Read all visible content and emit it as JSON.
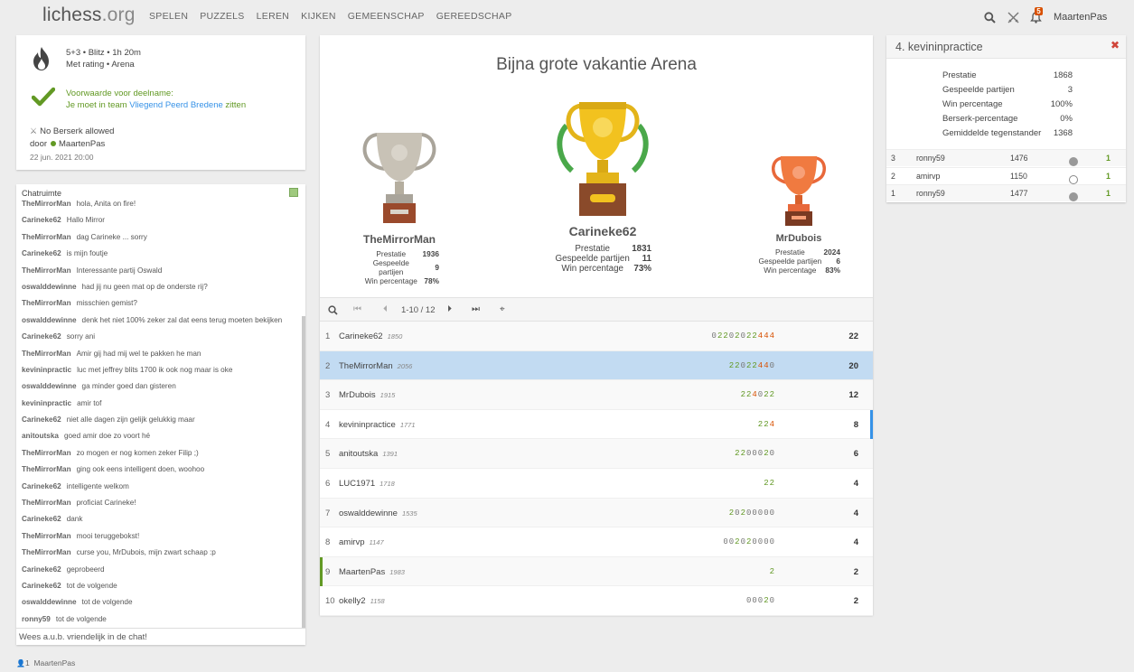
{
  "header": {
    "logo_main": "lichess",
    "logo_tld": ".org",
    "nav": [
      "SPELEN",
      "PUZZELS",
      "LEREN",
      "KIJKEN",
      "GEMEENSCHAP",
      "GEREEDSCHAP"
    ],
    "icons": [
      "search-icon",
      "swords-icon",
      "bell-icon"
    ],
    "notif_count": "5",
    "username": "MaartenPas"
  },
  "info": {
    "line1": "5+3 • Blitz • 1h 20m",
    "line2": "Met rating • Arena",
    "cond_title": "Voorwaarde voor deelname:",
    "cond_text": "Je moet in team ",
    "cond_link": "Vliegend Peerd Bredene",
    "cond_suffix": " zitten",
    "berserk": "No Berserk allowed",
    "by_label": "door",
    "by_user": "MaartenPas",
    "date": "22 jun. 2021 20:00"
  },
  "chat": {
    "title": "Chatruimte",
    "messages": [
      {
        "user": "TheMirrorMan",
        "text": "hola, Anita on fire!"
      },
      {
        "user": "Carineke62",
        "text": "Hallo Mirror"
      },
      {
        "user": "TheMirrorMan",
        "text": "dag Carineke ... sorry"
      },
      {
        "user": "Carineke62",
        "text": "is mijn foutje"
      },
      {
        "user": "TheMirrorMan",
        "text": "Interessante partij Oswald"
      },
      {
        "user": "oswalddewinne",
        "text": "had jij nu geen mat op de onderste rij?"
      },
      {
        "user": "TheMirrorMan",
        "text": "misschien gemist?"
      },
      {
        "user": "oswalddewinne",
        "text": "denk het niet 100% zeker zal dat eens terug moeten bekijken"
      },
      {
        "user": "Carineke62",
        "text": "sorry ani"
      },
      {
        "user": "TheMirrorMan",
        "text": "Amir gij had mij wel te pakken he man"
      },
      {
        "user": "kevininpractic",
        "text": "luc met jeffrey blits 1700 ik ook nog maar is oke"
      },
      {
        "user": "oswalddewinne",
        "text": "ga minder goed dan gisteren"
      },
      {
        "user": "kevininpractic",
        "text": "amir tof"
      },
      {
        "user": "Carineke62",
        "text": "niet alle dagen zijn gelijk gelukkig maar"
      },
      {
        "user": "anitoutska",
        "text": "goed amir doe zo voort hé"
      },
      {
        "user": "TheMirrorMan",
        "text": "zo mogen er nog komen zeker Filip ;)"
      },
      {
        "user": "TheMirrorMan",
        "text": "ging ook eens intelligent doen, woohoo"
      },
      {
        "user": "Carineke62",
        "text": "intelligente welkom"
      },
      {
        "user": "TheMirrorMan",
        "text": "proficiat Carineke!"
      },
      {
        "user": "Carineke62",
        "text": "dank"
      },
      {
        "user": "TheMirrorMan",
        "text": "mooi teruggebokst!"
      },
      {
        "user": "TheMirrorMan",
        "text": "curse you, MrDubois, mijn zwart schaap :p"
      },
      {
        "user": "Carineke62",
        "text": "geprobeerd"
      },
      {
        "user": "Carineke62",
        "text": "tot de volgende"
      },
      {
        "user": "oswalddewinne",
        "text": "tot de volgende"
      },
      {
        "user": "ronny59",
        "text": "tot de volgende"
      }
    ],
    "input_placeholder": "Wees a.u.b. vriendelijk in de chat!"
  },
  "spectators": {
    "count": "1",
    "user": "MaartenPas"
  },
  "tournament": {
    "title": "Bijna grote vakantie Arena",
    "podium": [
      {
        "place": 1,
        "name": "Carineke62",
        "stats": [
          {
            "label": "Prestatie",
            "value": "1831"
          },
          {
            "label": "Gespeelde partijen",
            "value": "11"
          },
          {
            "label": "Win percentage",
            "value": "73%"
          }
        ]
      },
      {
        "place": 2,
        "name": "TheMirrorMan",
        "stats": [
          {
            "label": "Prestatie",
            "value": "1936"
          },
          {
            "label": "Gespeelde partijen",
            "value": "9"
          },
          {
            "label": "Win percentage",
            "value": "78%"
          }
        ]
      },
      {
        "place": 3,
        "name": "MrDubois",
        "stats": [
          {
            "label": "Prestatie",
            "value": "2024"
          },
          {
            "label": "Gespeelde partijen",
            "value": "6"
          },
          {
            "label": "Win percentage",
            "value": "83%"
          }
        ]
      }
    ],
    "pager": "1-10 / 12",
    "standings": [
      {
        "rank": "1",
        "name": "Carineke62",
        "rating": "1850",
        "sheet": "02202022444",
        "score": "22"
      },
      {
        "rank": "2",
        "name": "TheMirrorMan",
        "rating": "2056",
        "sheet": "22022440",
        "score": "20",
        "selected": true
      },
      {
        "rank": "3",
        "name": "MrDubois",
        "rating": "1915",
        "sheet": "224022",
        "score": "12"
      },
      {
        "rank": "4",
        "name": "kevininpractice",
        "rating": "1771",
        "sheet": "224",
        "score": "8",
        "marked": true
      },
      {
        "rank": "5",
        "name": "anitoutska",
        "rating": "1391",
        "sheet": "2200020",
        "score": "6"
      },
      {
        "rank": "6",
        "name": "LUC1971",
        "rating": "1718",
        "sheet": "22",
        "score": "4"
      },
      {
        "rank": "7",
        "name": "oswalddewinne",
        "rating": "1535",
        "sheet": "20200000",
        "score": "4"
      },
      {
        "rank": "8",
        "name": "amirvp",
        "rating": "1147",
        "sheet": "002020000",
        "score": "4"
      },
      {
        "rank": "9",
        "name": "MaartenPas",
        "rating": "1983",
        "sheet": "2",
        "score": "2",
        "me": true
      },
      {
        "rank": "10",
        "name": "okelly2",
        "rating": "1158",
        "sheet": "00020",
        "score": "2"
      }
    ]
  },
  "player_panel": {
    "title": "4. kevininpractice",
    "stats": [
      {
        "label": "Prestatie",
        "value": "1868"
      },
      {
        "label": "Gespeelde partijen",
        "value": "3"
      },
      {
        "label": "Win percentage",
        "value": "100%"
      },
      {
        "label": "Berserk-percentage",
        "value": "0%"
      },
      {
        "label": "Gemiddelde tegenstander",
        "value": "1368"
      }
    ],
    "games": [
      {
        "n": "3",
        "opponent": "ronny59",
        "rating": "1476",
        "color": "black",
        "result": "1"
      },
      {
        "n": "2",
        "opponent": "amirvp",
        "rating": "1150",
        "color": "white",
        "result": "1"
      },
      {
        "n": "1",
        "opponent": "ronny59",
        "rating": "1477",
        "color": "black",
        "result": "1"
      }
    ]
  }
}
